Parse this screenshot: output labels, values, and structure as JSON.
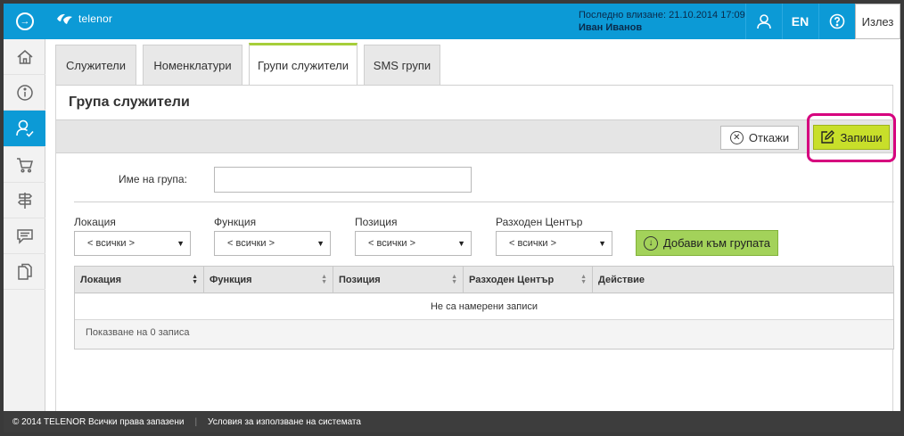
{
  "header": {
    "logo_text": "telenor",
    "last_login_label": "Последно влизане: 21.10.2014 17:09",
    "user_name": "Иван Иванов",
    "lang_label": "EN",
    "logout_label": "Излез",
    "brand_color": "#0c9ad6"
  },
  "sidebar": {
    "items": [
      {
        "name": "home-icon",
        "active": false
      },
      {
        "name": "info-icon",
        "active": false
      },
      {
        "name": "user-check-icon",
        "active": true
      },
      {
        "name": "cart-icon",
        "active": false
      },
      {
        "name": "signpost-icon",
        "active": false
      },
      {
        "name": "chat-icon",
        "active": false
      },
      {
        "name": "documents-icon",
        "active": false
      }
    ]
  },
  "tabs": [
    {
      "label": "Служители",
      "active": false
    },
    {
      "label": "Номенклатури",
      "active": false
    },
    {
      "label": "Групи служители",
      "active": true
    },
    {
      "label": "SMS групи",
      "active": false
    }
  ],
  "page": {
    "title": "Група служители"
  },
  "toolbar": {
    "cancel_label": "Откажи",
    "save_label": "Запиши",
    "save_color": "#c8df2a",
    "highlight_color": "#d6007e"
  },
  "form": {
    "group_name_label": "Име на група:",
    "group_name_value": ""
  },
  "filters": [
    {
      "label": "Локация",
      "value": "< всички >"
    },
    {
      "label": "Функция",
      "value": "< всички >"
    },
    {
      "label": "Позиция",
      "value": "< всички >"
    },
    {
      "label": "Разходен Център",
      "value": "< всички >"
    }
  ],
  "add_button_label": "Добави към групата",
  "table": {
    "columns": [
      "Локация",
      "Функция",
      "Позиция",
      "Разходен Център",
      "Действие"
    ],
    "empty_text": "Не са намерени записи",
    "footer_text": "Показване на 0 записа"
  },
  "footer": {
    "copyright": "© 2014 TELENOR Всички права запазени",
    "terms": "Условия за използване на системата"
  }
}
